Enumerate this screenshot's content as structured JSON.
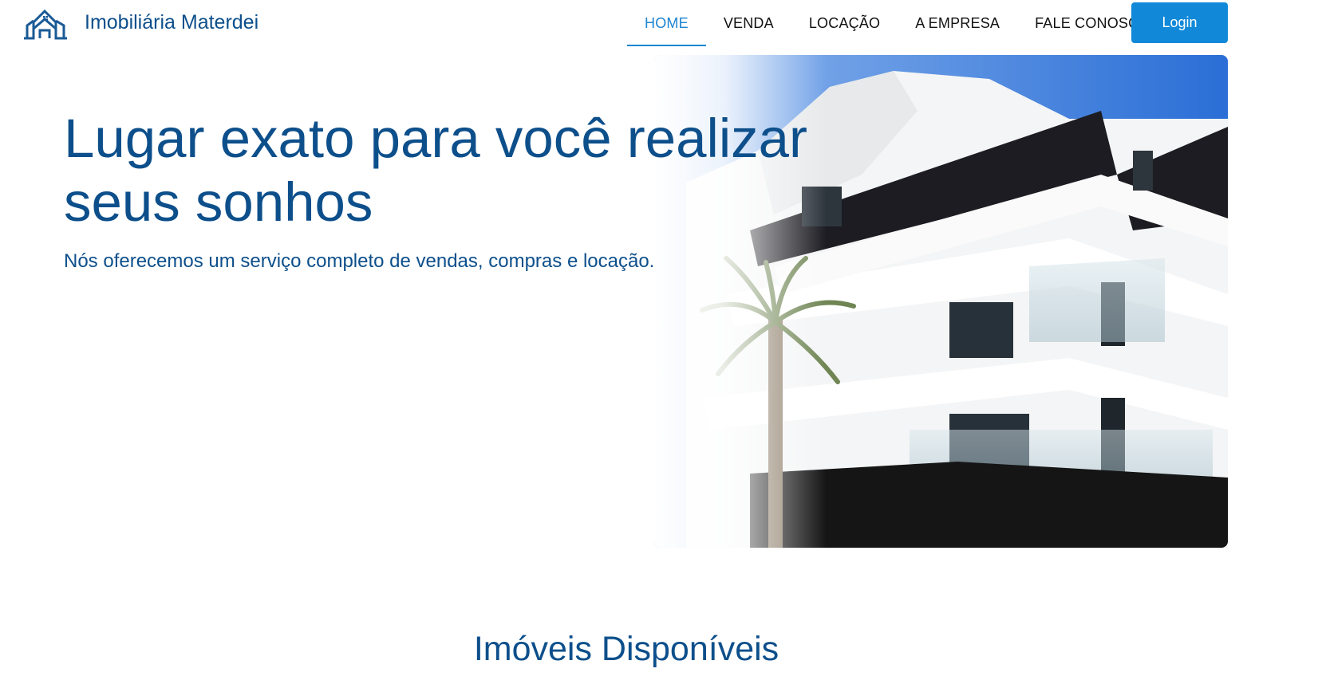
{
  "brand": {
    "name": "Imobiliária Materdei",
    "logo_icon": "house-building-icon"
  },
  "nav": {
    "items": [
      {
        "label": "HOME",
        "active": true
      },
      {
        "label": "VENDA",
        "active": false
      },
      {
        "label": "LOCAÇÃO",
        "active": false
      },
      {
        "label": "A EMPRESA",
        "active": false
      },
      {
        "label": "FALE CONOSCO",
        "active": false
      }
    ],
    "login_label": "Login"
  },
  "hero": {
    "title": "Lugar exato para você realizar seus sonhos",
    "subtitle": "Nós oferecemos um serviço completo de vendas, compras e locação."
  },
  "section": {
    "title": "Imóveis Disponíveis"
  },
  "colors": {
    "primary": "#0d4f8b",
    "accent": "#1289d8",
    "nav_active": "#1d84d0"
  }
}
